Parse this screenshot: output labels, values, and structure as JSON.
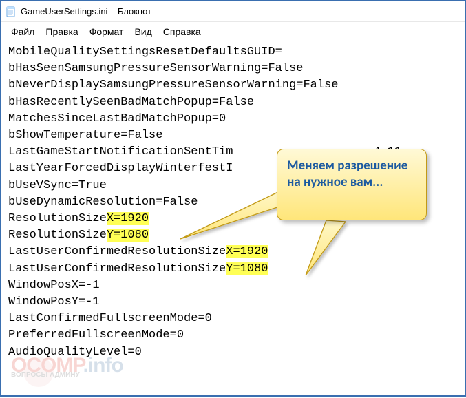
{
  "titlebar": {
    "icon_name": "notepad-icon",
    "title": "GameUserSettings.ini – Блокнот"
  },
  "menubar": {
    "items": [
      "Файл",
      "Правка",
      "Формат",
      "Вид",
      "Справка"
    ]
  },
  "editor": {
    "lines": [
      {
        "text": "MobileQualitySettingsResetDefaultsGUID="
      },
      {
        "text": "bHasSeenSamsungPressureSensorWarning=False"
      },
      {
        "text": "bNeverDisplaySamsungPressureSensorWarning=False"
      },
      {
        "text": "bHasRecentlySeenBadMatchPopup=False"
      },
      {
        "text": "MatchesSinceLastBadMatchPopup=0"
      },
      {
        "text": "bShowTemperature=False"
      },
      {
        "pre": "LastGameStartNotificationSentTim",
        "gap": "                    ",
        "post": "4.11"
      },
      {
        "text": "LastYearForcedDisplayWinterfestI"
      },
      {
        "text": "bUseVSync=True"
      },
      {
        "text": "bUseDynamicResolution=False",
        "caret_after": true
      },
      {
        "pre": "ResolutionSize",
        "hl": "X=1920"
      },
      {
        "pre": "ResolutionSize",
        "hl": "Y=1080"
      },
      {
        "pre": "LastUserConfirmedResolutionSize",
        "hl": "X=1920"
      },
      {
        "pre": "LastUserConfirmedResolutionSize",
        "hl": "Y=1080"
      },
      {
        "text": "WindowPosX=-1"
      },
      {
        "text": "WindowPosY=-1"
      },
      {
        "text": "LastConfirmedFullscreenMode=0"
      },
      {
        "text": "PreferredFullscreenMode=0"
      },
      {
        "text": "AudioQualityLevel=0"
      }
    ]
  },
  "callout": {
    "text": "Меняем разрешение на нужное вам..."
  },
  "watermark": {
    "top1": "OCOMP",
    "top2": ".info",
    "sub": "ВОПРОСЫ АДМИНУ"
  }
}
